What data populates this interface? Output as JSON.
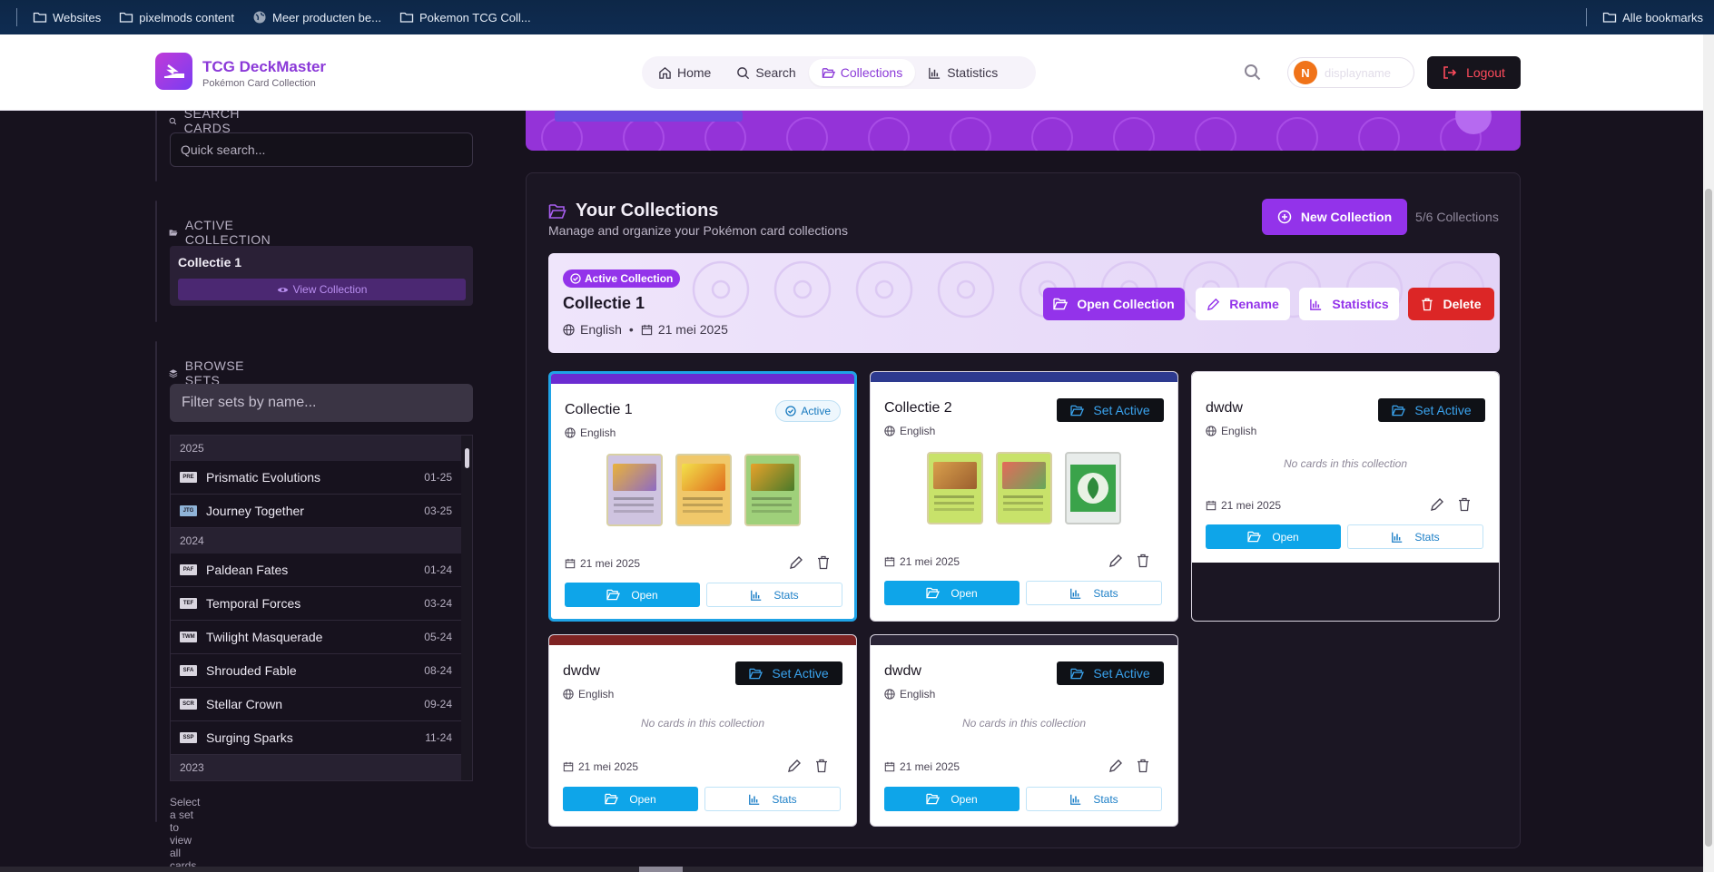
{
  "bookmarks": {
    "items": [
      {
        "label": "Websites"
      },
      {
        "label": "pixelmods content"
      },
      {
        "label": "Meer producten be..."
      },
      {
        "label": "Pokemon TCG Coll..."
      }
    ],
    "all_label": "Alle bookmarks"
  },
  "header": {
    "title": "TCG DeckMaster",
    "subtitle": "Pokémon Card Collection",
    "nav": [
      {
        "label": "Home"
      },
      {
        "label": "Search"
      },
      {
        "label": "Collections"
      },
      {
        "label": "Statistics"
      }
    ],
    "active_nav": "Collections",
    "avatar_initial": "N",
    "username": "displayname",
    "logout_label": "Logout"
  },
  "sidebar": {
    "search": {
      "title": "Search Cards",
      "placeholder": "Quick search..."
    },
    "active": {
      "title": "Active Collection",
      "name": "Collectie 1",
      "view_label": "View Collection"
    },
    "browse": {
      "title": "Browse Sets",
      "placeholder": "Filter sets by name...",
      "groups": [
        {
          "year": "2025",
          "sets": [
            {
              "name": "Prismatic Evolutions",
              "code": "PRE",
              "date": "01-25"
            },
            {
              "name": "Journey Together",
              "code": "JTG",
              "date": "03-25"
            }
          ]
        },
        {
          "year": "2024",
          "sets": [
            {
              "name": "Paldean Fates",
              "code": "PAF",
              "date": "01-24"
            },
            {
              "name": "Temporal Forces",
              "code": "TEF",
              "date": "03-24"
            },
            {
              "name": "Twilight Masquerade",
              "code": "TWM",
              "date": "05-24"
            },
            {
              "name": "Shrouded Fable",
              "code": "SFA",
              "date": "08-24"
            },
            {
              "name": "Stellar Crown",
              "code": "SCR",
              "date": "09-24"
            },
            {
              "name": "Surging Sparks",
              "code": "SSP",
              "date": "11-24"
            }
          ]
        },
        {
          "year": "2023",
          "sets": []
        }
      ],
      "hint": "Select a set to view all cards in the set."
    }
  },
  "main": {
    "title": "Your Collections",
    "subtitle": "Manage and organize your Pokémon card collections",
    "new_label": "New Collection",
    "count": "5/6 Collections",
    "active_banner": {
      "badge": "Active Collection",
      "name": "Collectie 1",
      "language": "English",
      "date": "21 mei 2025",
      "open_label": "Open Collection",
      "rename_label": "Rename",
      "stats_label": "Statistics",
      "delete_label": "Delete"
    },
    "labels": {
      "active": "Active",
      "set_active": "Set Active",
      "open": "Open",
      "stats": "Stats",
      "empty": "No cards in this collection"
    },
    "collections": [
      {
        "name": "Collectie 1",
        "language": "English",
        "date": "21 mei 2025",
        "active": true,
        "strip_color": "#6b2cd1",
        "has_cards": true
      },
      {
        "name": "Collectie 2",
        "language": "English",
        "date": "21 mei 2025",
        "active": false,
        "strip_color": "#2d3a8f",
        "has_cards": true
      },
      {
        "name": "dwdw",
        "language": "English",
        "date": "21 mei 2025",
        "active": false,
        "strip_color": "#ffffff",
        "has_cards": false
      },
      {
        "name": "dwdw",
        "language": "English",
        "date": "21 mei 2025",
        "active": false,
        "strip_color": "#7e2323",
        "has_cards": false
      },
      {
        "name": "dwdw",
        "language": "English",
        "date": "21 mei 2025",
        "active": false,
        "strip_color": "#2a2436",
        "has_cards": false
      }
    ]
  },
  "colors": {
    "accent": "#9333ea",
    "blue": "#0ea5e9",
    "danger": "#dc2626",
    "bg": "#17121e"
  }
}
